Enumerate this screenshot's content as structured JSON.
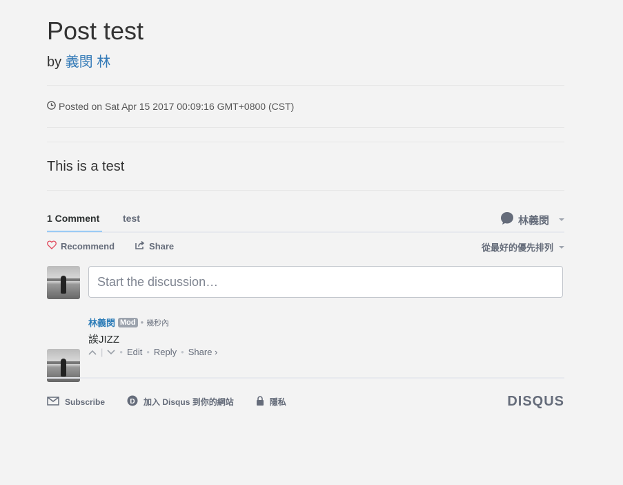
{
  "post": {
    "title": "Post test",
    "by_label": "by",
    "author": "義閔 林",
    "posted_on": "Posted on Sat Apr 15 2017 00:09:16 GMT+0800 (CST)",
    "body": "This is a test"
  },
  "disqus": {
    "tabs": [
      {
        "label": "1 Comment",
        "active": true
      },
      {
        "label": "test",
        "active": false
      }
    ],
    "user": "林義閔",
    "recommend": "Recommend",
    "share": "Share",
    "sort": "從最好的優先排列",
    "composer_placeholder": "Start the discussion…",
    "comment": {
      "author": "林義閔",
      "badge": "Mod",
      "time": "幾秒內",
      "text": "誒JIZZ",
      "edit": "Edit",
      "reply": "Reply",
      "share": "Share ›"
    },
    "footer": {
      "subscribe": "Subscribe",
      "add_disqus": "加入 Disqus 到你的網站",
      "privacy": "隱私",
      "brand": "DISQUS"
    },
    "colors": {
      "link": "#337ab7",
      "accent": "#2e9fff",
      "muted": "#656c7a"
    }
  }
}
